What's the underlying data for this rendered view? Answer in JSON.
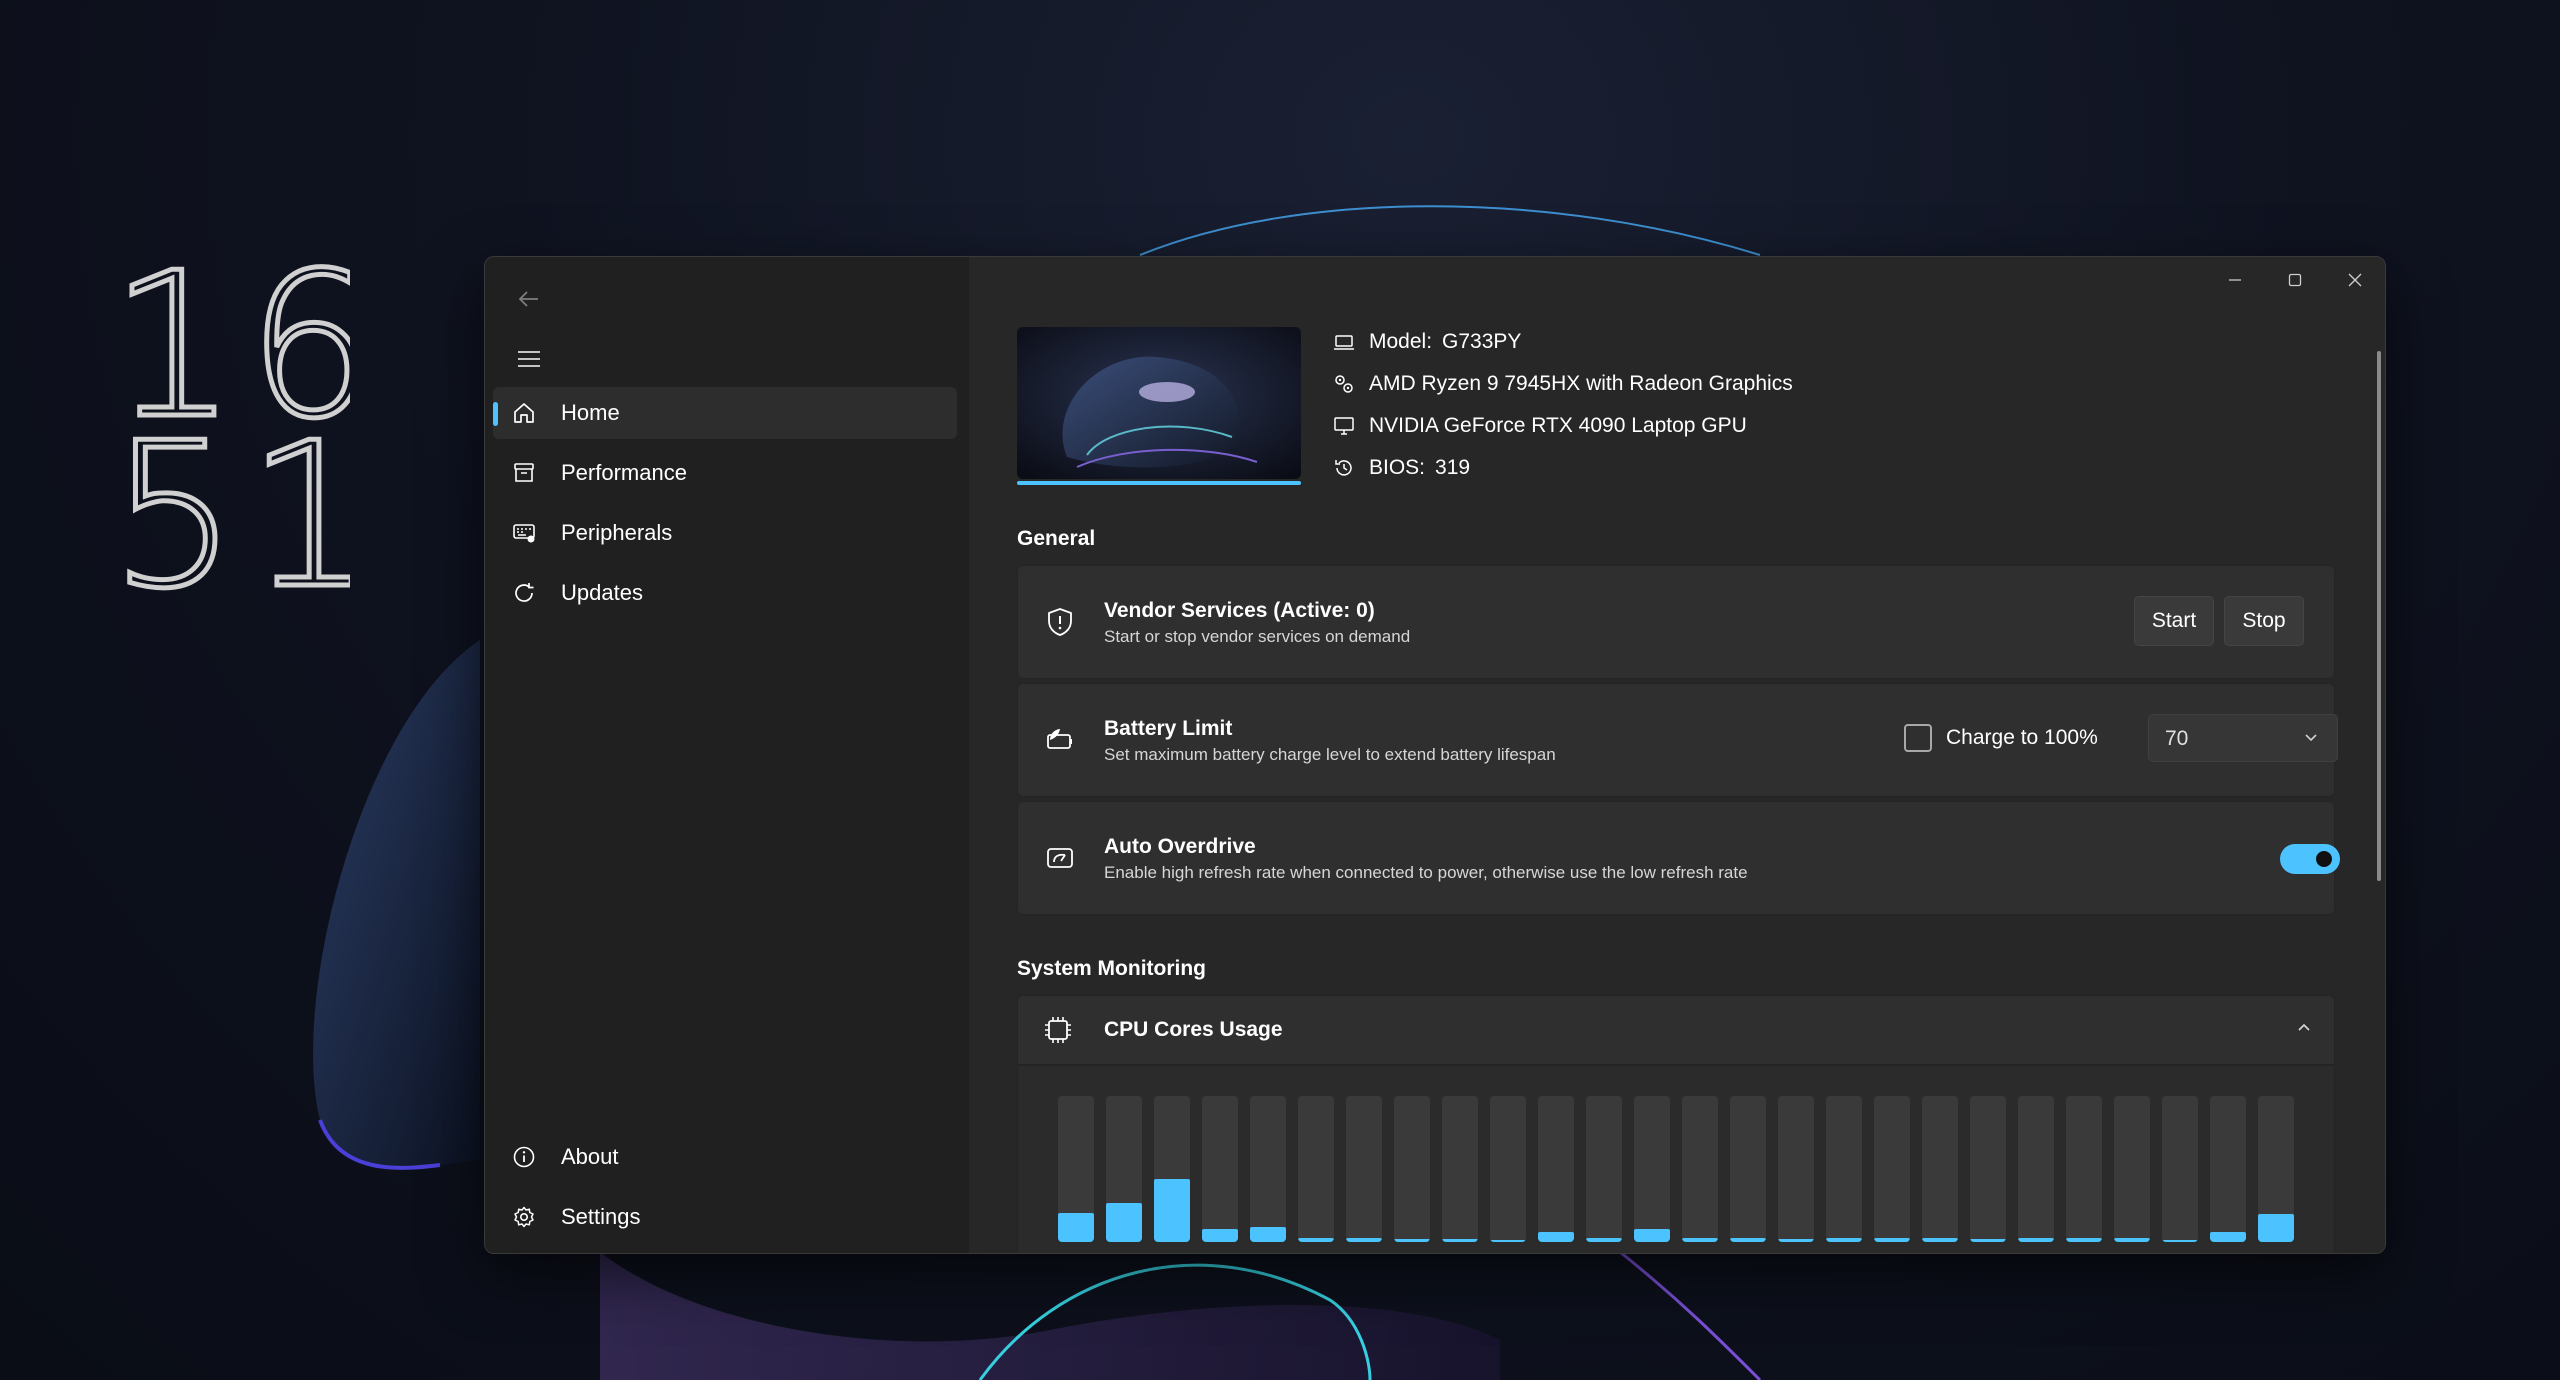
{
  "clock": {
    "hours": "16",
    "minutes": "51"
  },
  "window": {
    "caption": {
      "minimize_icon": "minimize-icon",
      "maximize_icon": "maximize-icon",
      "close_icon": "close-icon"
    }
  },
  "sidebar": {
    "back_icon": "back-arrow-icon",
    "menu_icon": "hamburger-icon",
    "items": [
      {
        "label": "Home",
        "icon": "home-icon",
        "active": true
      },
      {
        "label": "Performance",
        "icon": "archive-icon"
      },
      {
        "label": "Peripherals",
        "icon": "keyboard-icon"
      },
      {
        "label": "Updates",
        "icon": "refresh-icon"
      }
    ],
    "footer_items": [
      {
        "label": "About",
        "icon": "info-icon"
      },
      {
        "label": "Settings",
        "icon": "gear-icon"
      }
    ]
  },
  "device": {
    "model_label": "Model:",
    "model_value": "G733PY",
    "cpu": "AMD Ryzen 9 7945HX with Radeon Graphics",
    "gpu": "NVIDIA GeForce RTX 4090 Laptop GPU",
    "bios_label": "BIOS:",
    "bios_value": "319"
  },
  "general": {
    "title": "General",
    "vendor": {
      "title": "Vendor Services (Active: 0)",
      "desc": "Start or stop vendor services on demand",
      "start_label": "Start",
      "stop_label": "Stop"
    },
    "battery": {
      "title": "Battery Limit",
      "desc": "Set maximum battery charge level to extend battery lifespan",
      "charge_label": "Charge to 100%",
      "charge_checked": false,
      "limit_value": "70"
    },
    "overdrive": {
      "title": "Auto Overdrive",
      "desc": "Enable high refresh rate when connected to power, otherwise use the low refresh rate",
      "enabled": true
    }
  },
  "monitoring": {
    "title": "System Monitoring",
    "cpu_cores": {
      "title": "CPU Cores Usage",
      "expanded": true,
      "usage": [
        0.2,
        0.27,
        0.43,
        0.09,
        0.1,
        0.03,
        0.03,
        0.02,
        0.02,
        0.01,
        0.07,
        0.03,
        0.09,
        0.03,
        0.03,
        0.02,
        0.03,
        0.03,
        0.03,
        0.02,
        0.03,
        0.03,
        0.03,
        0.01,
        0.07,
        0.19
      ]
    }
  },
  "accent_color": "#4cc2ff"
}
